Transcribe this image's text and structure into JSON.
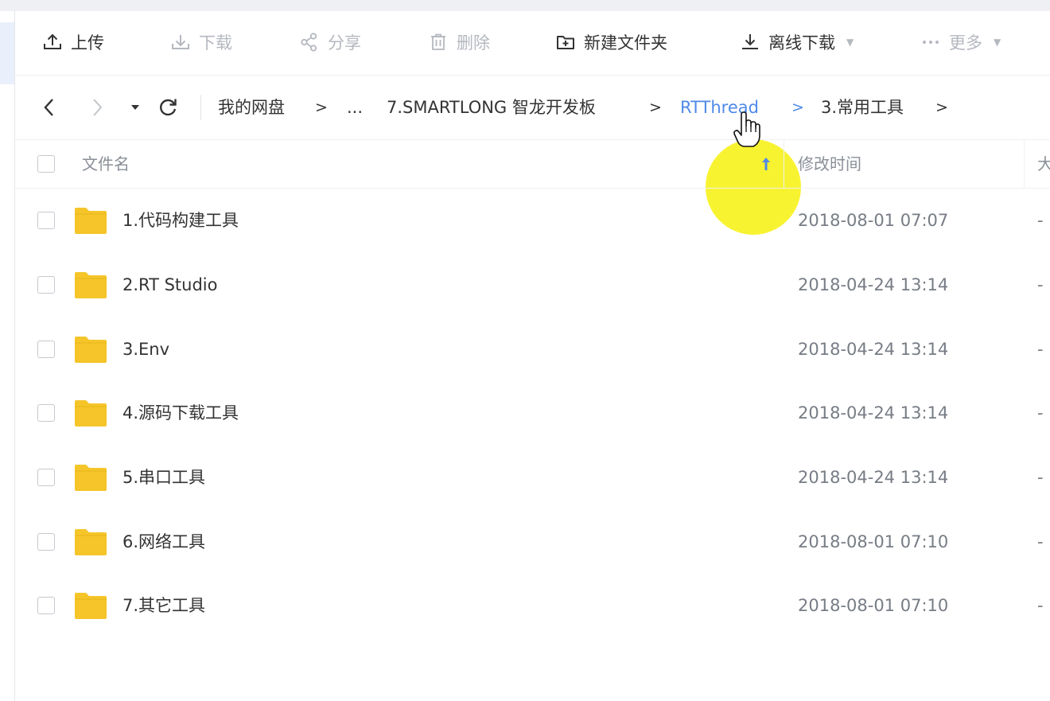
{
  "toolbar": {
    "upload": "上传",
    "download": "下载",
    "share": "分享",
    "delete": "删除",
    "new_folder": "新建文件夹",
    "offline_download": "离线下载",
    "more": "更多"
  },
  "breadcrumb": {
    "items": [
      "我的网盘",
      "...",
      "7.SMARTLONG 智龙开发板",
      "RTThread",
      "3.常用工具"
    ],
    "separator": ">",
    "active_index": 3
  },
  "table": {
    "headers": {
      "name": "文件名",
      "modified": "修改时间",
      "size": "大"
    },
    "sort": {
      "column": "name",
      "direction": "ascending"
    },
    "rows": [
      {
        "name": "1.代码构建工具",
        "modified": "2018-08-01 07:07",
        "size": "-"
      },
      {
        "name": "2.RT Studio",
        "modified": "2018-04-24 13:14",
        "size": "-"
      },
      {
        "name": "3.Env",
        "modified": "2018-04-24 13:14",
        "size": "-"
      },
      {
        "name": "4.源码下载工具",
        "modified": "2018-04-24 13:14",
        "size": "-"
      },
      {
        "name": "5.串口工具",
        "modified": "2018-04-24 13:14",
        "size": "-"
      },
      {
        "name": "6.网络工具",
        "modified": "2018-08-01 07:10",
        "size": "-"
      },
      {
        "name": "7.其它工具",
        "modified": "2018-08-01 07:10",
        "size": "-"
      }
    ]
  },
  "colors": {
    "accent": "#4f8ae8",
    "folder": "#f5c529",
    "cursor_highlight": "#f7f220",
    "disabled_text": "#b4b8bf"
  },
  "icons": {
    "upload": "upload-icon",
    "download": "download-icon",
    "share": "share-icon",
    "delete": "trash-icon",
    "new_folder": "new-folder-icon",
    "offline_download": "offline-download-icon",
    "more": "more-dots-icon",
    "back": "chevron-left-icon",
    "forward": "chevron-right-icon",
    "history": "caret-down-icon",
    "refresh": "refresh-icon",
    "folder": "folder-icon",
    "sort": "arrow-up-icon",
    "pointer": "hand-pointer-icon"
  }
}
